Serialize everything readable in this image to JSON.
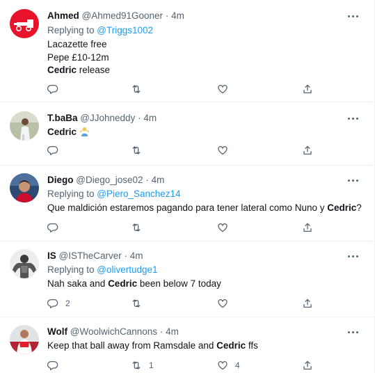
{
  "tweets": [
    {
      "name": "Ahmed",
      "handle": "@Ahmed91Gooner",
      "time": "4m",
      "replying_prefix": "Replying to ",
      "replying_to": "@Triggs1002",
      "lines": [
        [
          {
            "t": "Lacazette free",
            "b": false
          }
        ],
        [
          {
            "t": "Pepe £10-12m",
            "b": false
          }
        ],
        [
          {
            "t": "Cedric",
            "b": true
          },
          {
            "t": " release",
            "b": false
          }
        ]
      ],
      "reply_count": "",
      "retweet_count": "",
      "like_count": ""
    },
    {
      "name": "T.baBa",
      "handle": "@JJohneddy",
      "time": "4m",
      "lines": [
        [
          {
            "t": "Cedric",
            "b": true
          },
          {
            "t": " ",
            "b": false
          }
        ]
      ],
      "emoji": "person-shrugging-emoji",
      "reply_count": "",
      "retweet_count": "",
      "like_count": ""
    },
    {
      "name": "Diego",
      "handle": "@Diego_jose02",
      "time": "4m",
      "replying_prefix": "Replying to ",
      "replying_to": "@Piero_Sanchez14",
      "lines": [
        [
          {
            "t": "Que maldición estaremos pagando para tener lateral como Nuno y ",
            "b": false
          },
          {
            "t": "Cedric",
            "b": true
          },
          {
            "t": "?",
            "b": false
          }
        ]
      ],
      "reply_count": "",
      "retweet_count": "",
      "like_count": ""
    },
    {
      "name": "IS",
      "handle": "@ISTheCarver",
      "time": "4m",
      "replying_prefix": "Replying to ",
      "replying_to": "@olivertudge1",
      "lines": [
        [
          {
            "t": "Nah saka and ",
            "b": false
          },
          {
            "t": "Cedric",
            "b": true
          },
          {
            "t": " been below 7 today",
            "b": false
          }
        ]
      ],
      "reply_count": "2",
      "retweet_count": "",
      "like_count": ""
    },
    {
      "name": "Wolf",
      "handle": "@WoolwichCannons",
      "time": "4m",
      "lines": [
        [
          {
            "t": "Keep that ball away from Ramsdale and ",
            "b": false
          },
          {
            "t": "Cedric",
            "b": true
          },
          {
            "t": " ffs",
            "b": false
          }
        ]
      ],
      "reply_count": "",
      "retweet_count": "1",
      "like_count": "4"
    }
  ],
  "separator": "·",
  "icons": {
    "reply": "reply-icon",
    "retweet": "retweet-icon",
    "like": "heart-icon",
    "share": "share-icon",
    "more": "more-icon"
  },
  "colors": {
    "text": "#0f1419",
    "secondary": "#536471",
    "link": "#1d9bf0",
    "border": "#eff3f4"
  }
}
